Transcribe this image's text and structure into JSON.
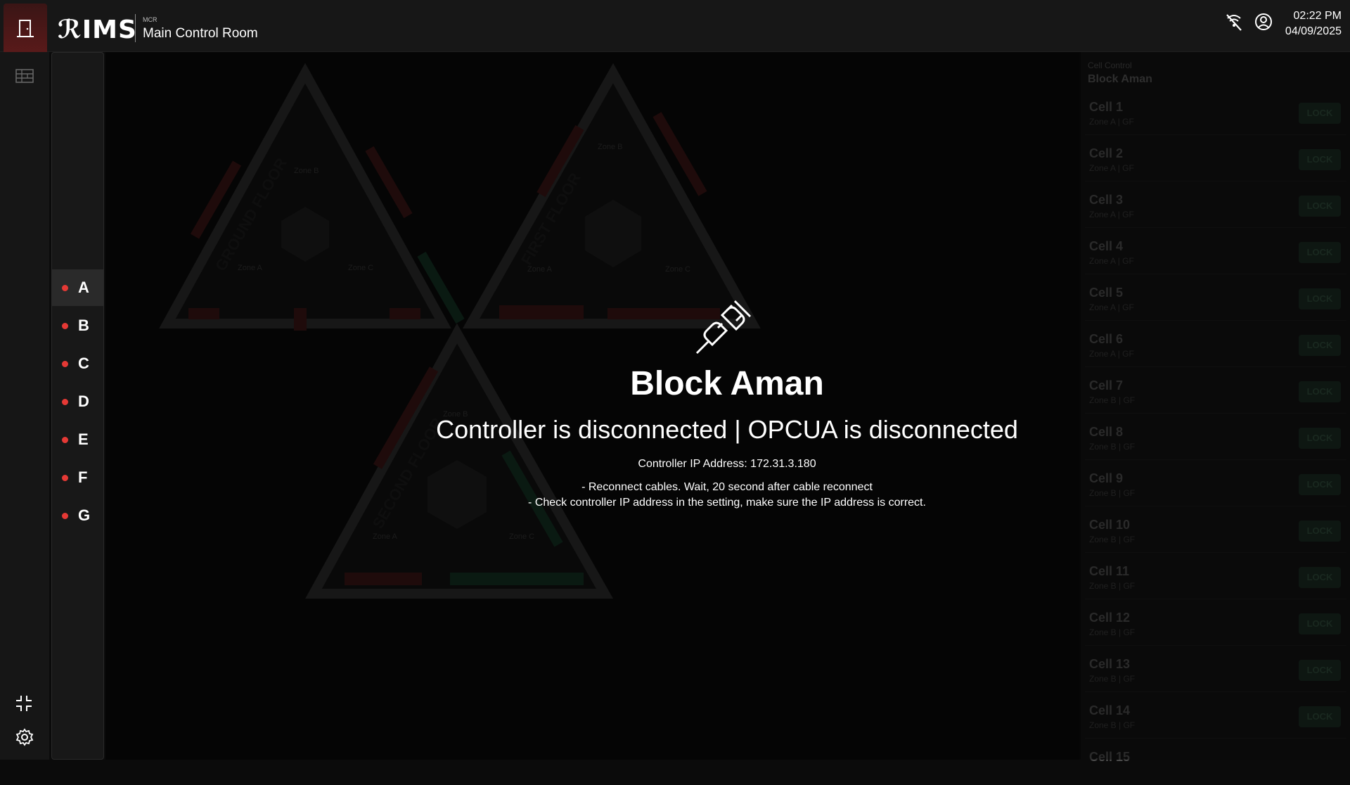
{
  "app": {
    "logo": "ℛIMS",
    "crumb_small": "MCR",
    "crumb_main": "Main Control Room",
    "time": "02:22 PM",
    "date": "04/09/2025"
  },
  "blocks": [
    "A",
    "B",
    "C",
    "D",
    "E",
    "F",
    "G"
  ],
  "active_block": "A",
  "colors": {
    "accent_red": "#e53935",
    "lock_bg": "#1b2a22"
  },
  "floors": [
    "GROUND FLOOR",
    "FIRST FLOOR",
    "SECOND FLOOR"
  ],
  "zones": [
    "Zone A",
    "Zone B",
    "Zone C"
  ],
  "cell_panel": {
    "label": "Cell Control",
    "title": "Block Aman",
    "lock_label": "LOCK",
    "cells": [
      {
        "name": "Cell 1",
        "zone": "Zone A | GF"
      },
      {
        "name": "Cell 2",
        "zone": "Zone A | GF"
      },
      {
        "name": "Cell 3",
        "zone": "Zone A | GF"
      },
      {
        "name": "Cell 4",
        "zone": "Zone A | GF"
      },
      {
        "name": "Cell 5",
        "zone": "Zone A | GF"
      },
      {
        "name": "Cell 6",
        "zone": "Zone A | GF"
      },
      {
        "name": "Cell 7",
        "zone": "Zone B | GF"
      },
      {
        "name": "Cell 8",
        "zone": "Zone B | GF"
      },
      {
        "name": "Cell 9",
        "zone": "Zone B | GF"
      },
      {
        "name": "Cell 10",
        "zone": "Zone B | GF"
      },
      {
        "name": "Cell 11",
        "zone": "Zone B | GF"
      },
      {
        "name": "Cell 12",
        "zone": "Zone B | GF"
      },
      {
        "name": "Cell 13",
        "zone": "Zone B | GF"
      },
      {
        "name": "Cell 14",
        "zone": "Zone B | GF"
      },
      {
        "name": "Cell 15",
        "zone": ""
      }
    ]
  },
  "overlay": {
    "title": "Block Aman",
    "status": "Controller is disconnected | OPCUA is disconnected",
    "ip": "Controller IP Address: 172.31.3.180",
    "hint1": "- Reconnect cables. Wait, 20 second after cable reconnect",
    "hint2": "- Check controller IP address in the setting, make sure the IP address is correct."
  }
}
